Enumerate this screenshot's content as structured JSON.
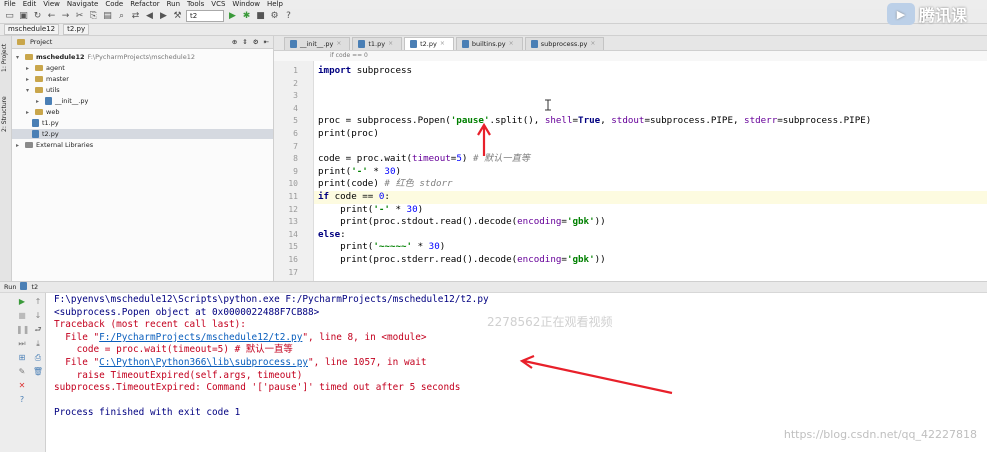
{
  "menu": [
    "File",
    "Edit",
    "View",
    "Navigate",
    "Code",
    "Refactor",
    "Run",
    "Tools",
    "VCS",
    "Window",
    "Help"
  ],
  "toolbar": {
    "run_config": "t2"
  },
  "navbar": {
    "crumbs": [
      "mschedule12",
      "t2.py"
    ]
  },
  "side_tabs": {
    "project": "1: Project",
    "structure": "2: Structure"
  },
  "project_panel": {
    "header": "Project",
    "tree": [
      {
        "label": "mschedule12",
        "path": "F:\\PycharmProjects\\mschedule12",
        "level": 0
      },
      {
        "label": "agent",
        "level": 1
      },
      {
        "label": "master",
        "level": 1
      },
      {
        "label": "utils",
        "level": 1
      },
      {
        "label": "__init__.py",
        "level": 2
      },
      {
        "label": "web",
        "level": 1
      },
      {
        "label": "t1.py",
        "level": 1
      },
      {
        "label": "t2.py",
        "level": 1
      },
      {
        "label": "External Libraries",
        "level": 0
      }
    ]
  },
  "tabs": [
    "__init__.py",
    "t1.py",
    "t2.py",
    "builtins.py",
    "subprocess.py"
  ],
  "active_tab": "t2.py",
  "breadcrumb_bar": "if code == 0",
  "line_numbers": [
    "1",
    "2",
    "3",
    "4",
    "5",
    "6",
    "7",
    "8",
    "9",
    "10",
    "11",
    "12",
    "13",
    "14",
    "15",
    "16",
    "17"
  ],
  "code": [
    "import subprocess",
    "",
    "",
    "",
    "proc = subprocess.Popen('pause'.split(), shell=True, stdout=subprocess.PIPE, stderr=subprocess.PIPE)",
    "print(proc)",
    "",
    "code = proc.wait(timeout=5) # 默认一直等",
    "print('-' * 30)",
    "print(code) # 红色 stdorr",
    "if code == 0:",
    "    print('-' * 30)",
    "    print(proc.stdout.read().decode(encoding='gbk'))",
    "else:",
    "    print('~~~~~' * 30)",
    "    print(proc.stderr.read().decode(encoding='gbk'))",
    ""
  ],
  "run": {
    "header_label": "Run",
    "config": "t2",
    "console": [
      "F:\\pyenvs\\mschedule12\\Scripts\\python.exe F:/PycharmProjects/mschedule12/t2.py",
      "<subprocess.Popen object at 0x0000022488F7CB88>",
      "Traceback (most recent call last):",
      "  File \"F:/PycharmProjects/mschedule12/t2.py\", line 8, in <module>",
      "    code = proc.wait(timeout=5) # 默认一直等",
      "  File \"C:\\Python\\Python366\\lib\\subprocess.py\", line 1057, in wait",
      "    raise TimeoutExpired(self.args, timeout)",
      "subprocess.TimeoutExpired: Command '['pause']' timed out after 5 seconds",
      "",
      "Process finished with exit code 1"
    ]
  },
  "overlay_logo": "腾讯课",
  "viewer_count": "2278562正在观看视频",
  "watermark": "https://blog.csdn.net/qq_42227818",
  "colors": {
    "annotation_arrow": "#e8202a",
    "keyword": "#000080",
    "string": "#008000",
    "error": "#c3001e"
  }
}
